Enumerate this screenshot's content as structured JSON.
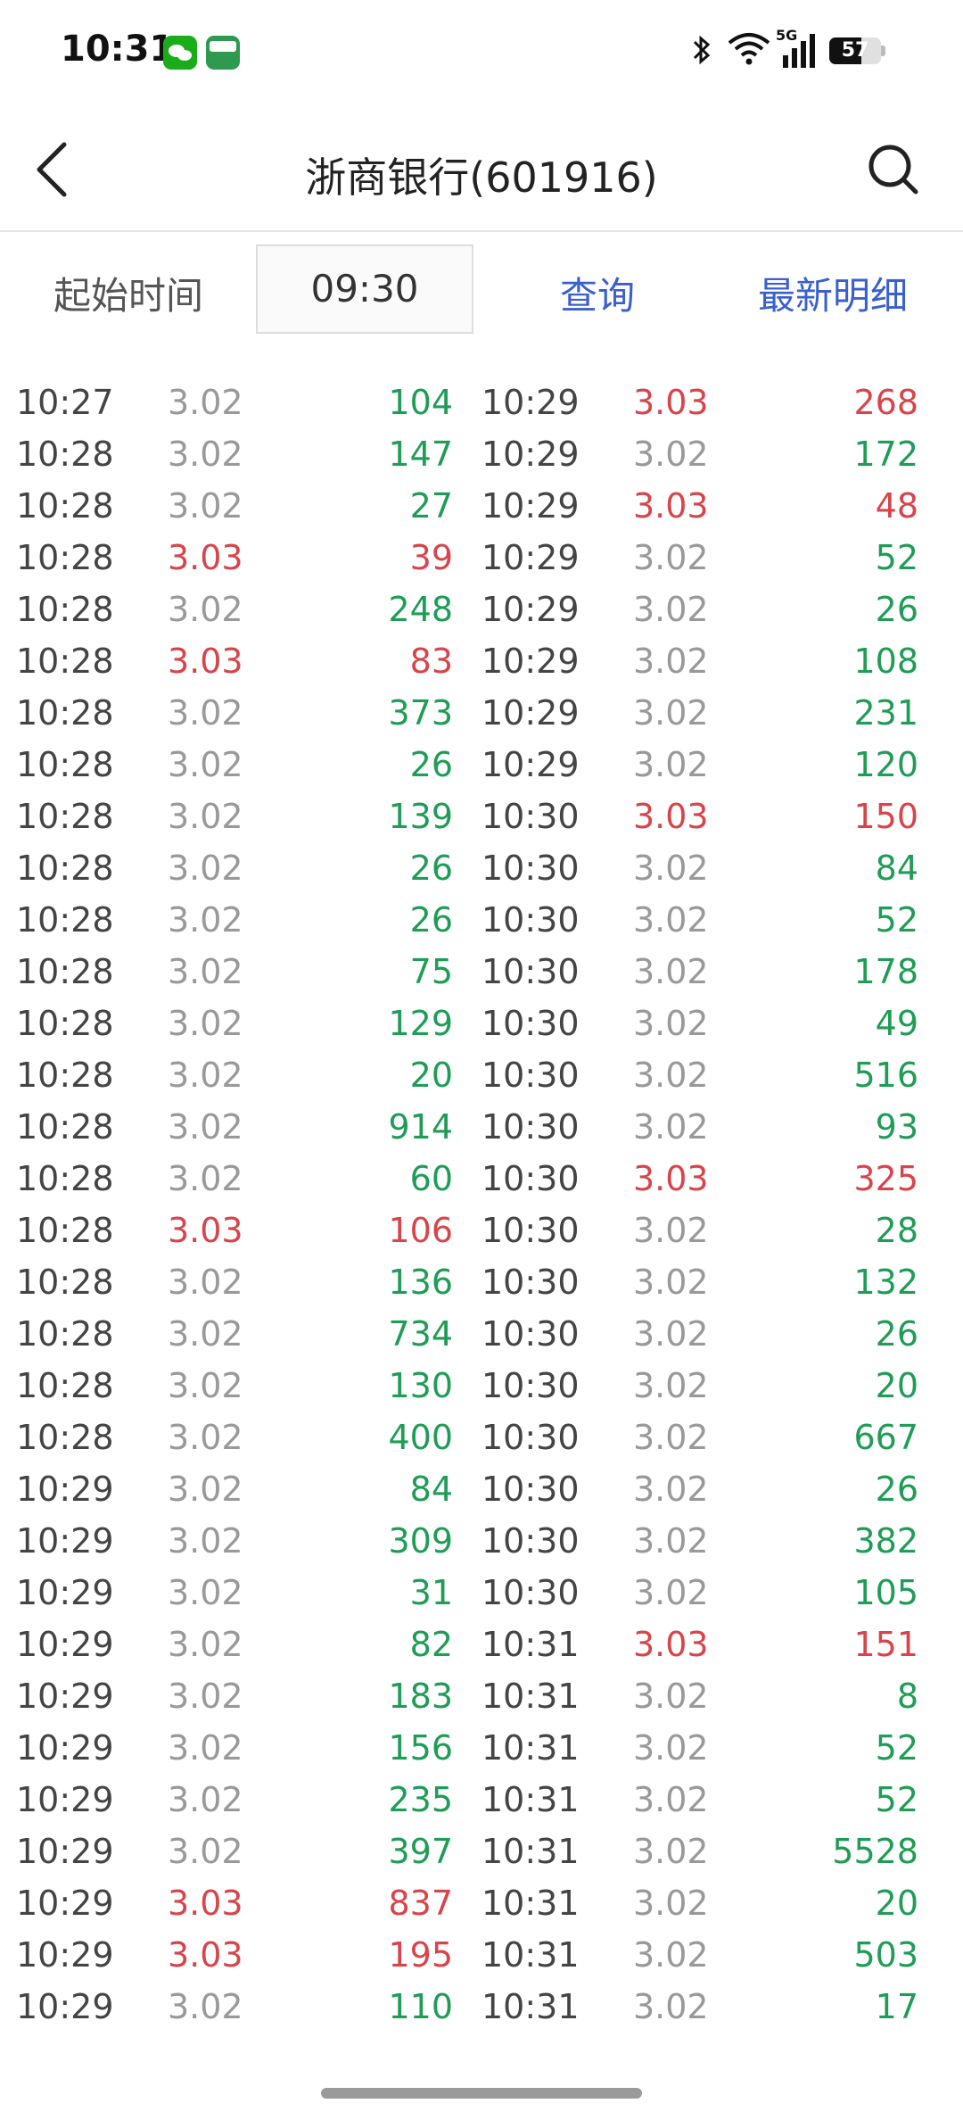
{
  "status_bar": {
    "time": "10:31",
    "battery": "57",
    "network": "5G",
    "icons": [
      "wechat-icon",
      "oppo-app-icon",
      "bluetooth-icon",
      "wifi-icon",
      "signal-icon",
      "battery-icon"
    ]
  },
  "header": {
    "title": "浙商银行(601916)",
    "back_icon": "back-arrow-icon",
    "search_icon": "search-icon"
  },
  "query": {
    "start_label": "起始时间",
    "start_time": "09:30",
    "query_button": "查询",
    "latest_button": "最新明细"
  },
  "colors": {
    "up": "#d7454b",
    "down": "#1f9c55",
    "flat": "#999999",
    "accent": "#3a5fcf"
  },
  "trades_left": [
    {
      "time": "10:27",
      "price": "3.02",
      "volume": "104",
      "dir": "down",
      "pdir": "flat"
    },
    {
      "time": "10:28",
      "price": "3.02",
      "volume": "147",
      "dir": "down",
      "pdir": "flat"
    },
    {
      "time": "10:28",
      "price": "3.02",
      "volume": "27",
      "dir": "down",
      "pdir": "flat"
    },
    {
      "time": "10:28",
      "price": "3.03",
      "volume": "39",
      "dir": "up",
      "pdir": "up"
    },
    {
      "time": "10:28",
      "price": "3.02",
      "volume": "248",
      "dir": "down",
      "pdir": "flat"
    },
    {
      "time": "10:28",
      "price": "3.03",
      "volume": "83",
      "dir": "up",
      "pdir": "up"
    },
    {
      "time": "10:28",
      "price": "3.02",
      "volume": "373",
      "dir": "down",
      "pdir": "flat"
    },
    {
      "time": "10:28",
      "price": "3.02",
      "volume": "26",
      "dir": "down",
      "pdir": "flat"
    },
    {
      "time": "10:28",
      "price": "3.02",
      "volume": "139",
      "dir": "down",
      "pdir": "flat"
    },
    {
      "time": "10:28",
      "price": "3.02",
      "volume": "26",
      "dir": "down",
      "pdir": "flat"
    },
    {
      "time": "10:28",
      "price": "3.02",
      "volume": "26",
      "dir": "down",
      "pdir": "flat"
    },
    {
      "time": "10:28",
      "price": "3.02",
      "volume": "75",
      "dir": "down",
      "pdir": "flat"
    },
    {
      "time": "10:28",
      "price": "3.02",
      "volume": "129",
      "dir": "down",
      "pdir": "flat"
    },
    {
      "time": "10:28",
      "price": "3.02",
      "volume": "20",
      "dir": "down",
      "pdir": "flat"
    },
    {
      "time": "10:28",
      "price": "3.02",
      "volume": "914",
      "dir": "down",
      "pdir": "flat"
    },
    {
      "time": "10:28",
      "price": "3.02",
      "volume": "60",
      "dir": "down",
      "pdir": "flat"
    },
    {
      "time": "10:28",
      "price": "3.03",
      "volume": "106",
      "dir": "up",
      "pdir": "up"
    },
    {
      "time": "10:28",
      "price": "3.02",
      "volume": "136",
      "dir": "down",
      "pdir": "flat"
    },
    {
      "time": "10:28",
      "price": "3.02",
      "volume": "734",
      "dir": "down",
      "pdir": "flat"
    },
    {
      "time": "10:28",
      "price": "3.02",
      "volume": "130",
      "dir": "down",
      "pdir": "flat"
    },
    {
      "time": "10:28",
      "price": "3.02",
      "volume": "400",
      "dir": "down",
      "pdir": "flat"
    },
    {
      "time": "10:29",
      "price": "3.02",
      "volume": "84",
      "dir": "down",
      "pdir": "flat"
    },
    {
      "time": "10:29",
      "price": "3.02",
      "volume": "309",
      "dir": "down",
      "pdir": "flat"
    },
    {
      "time": "10:29",
      "price": "3.02",
      "volume": "31",
      "dir": "down",
      "pdir": "flat"
    },
    {
      "time": "10:29",
      "price": "3.02",
      "volume": "82",
      "dir": "down",
      "pdir": "flat"
    },
    {
      "time": "10:29",
      "price": "3.02",
      "volume": "183",
      "dir": "down",
      "pdir": "flat"
    },
    {
      "time": "10:29",
      "price": "3.02",
      "volume": "156",
      "dir": "down",
      "pdir": "flat"
    },
    {
      "time": "10:29",
      "price": "3.02",
      "volume": "235",
      "dir": "down",
      "pdir": "flat"
    },
    {
      "time": "10:29",
      "price": "3.02",
      "volume": "397",
      "dir": "down",
      "pdir": "flat"
    },
    {
      "time": "10:29",
      "price": "3.03",
      "volume": "837",
      "dir": "up",
      "pdir": "up"
    },
    {
      "time": "10:29",
      "price": "3.03",
      "volume": "195",
      "dir": "up",
      "pdir": "up"
    },
    {
      "time": "10:29",
      "price": "3.02",
      "volume": "110",
      "dir": "down",
      "pdir": "flat"
    }
  ],
  "trades_right": [
    {
      "time": "10:29",
      "price": "3.03",
      "volume": "268",
      "dir": "up",
      "pdir": "up"
    },
    {
      "time": "10:29",
      "price": "3.02",
      "volume": "172",
      "dir": "down",
      "pdir": "flat"
    },
    {
      "time": "10:29",
      "price": "3.03",
      "volume": "48",
      "dir": "up",
      "pdir": "up"
    },
    {
      "time": "10:29",
      "price": "3.02",
      "volume": "52",
      "dir": "down",
      "pdir": "flat"
    },
    {
      "time": "10:29",
      "price": "3.02",
      "volume": "26",
      "dir": "down",
      "pdir": "flat"
    },
    {
      "time": "10:29",
      "price": "3.02",
      "volume": "108",
      "dir": "down",
      "pdir": "flat"
    },
    {
      "time": "10:29",
      "price": "3.02",
      "volume": "231",
      "dir": "down",
      "pdir": "flat"
    },
    {
      "time": "10:29",
      "price": "3.02",
      "volume": "120",
      "dir": "down",
      "pdir": "flat"
    },
    {
      "time": "10:30",
      "price": "3.03",
      "volume": "150",
      "dir": "up",
      "pdir": "up"
    },
    {
      "time": "10:30",
      "price": "3.02",
      "volume": "84",
      "dir": "down",
      "pdir": "flat"
    },
    {
      "time": "10:30",
      "price": "3.02",
      "volume": "52",
      "dir": "down",
      "pdir": "flat"
    },
    {
      "time": "10:30",
      "price": "3.02",
      "volume": "178",
      "dir": "down",
      "pdir": "flat"
    },
    {
      "time": "10:30",
      "price": "3.02",
      "volume": "49",
      "dir": "down",
      "pdir": "flat"
    },
    {
      "time": "10:30",
      "price": "3.02",
      "volume": "516",
      "dir": "down",
      "pdir": "flat"
    },
    {
      "time": "10:30",
      "price": "3.02",
      "volume": "93",
      "dir": "down",
      "pdir": "flat"
    },
    {
      "time": "10:30",
      "price": "3.03",
      "volume": "325",
      "dir": "up",
      "pdir": "up"
    },
    {
      "time": "10:30",
      "price": "3.02",
      "volume": "28",
      "dir": "down",
      "pdir": "flat"
    },
    {
      "time": "10:30",
      "price": "3.02",
      "volume": "132",
      "dir": "down",
      "pdir": "flat"
    },
    {
      "time": "10:30",
      "price": "3.02",
      "volume": "26",
      "dir": "down",
      "pdir": "flat"
    },
    {
      "time": "10:30",
      "price": "3.02",
      "volume": "20",
      "dir": "down",
      "pdir": "flat"
    },
    {
      "time": "10:30",
      "price": "3.02",
      "volume": "667",
      "dir": "down",
      "pdir": "flat"
    },
    {
      "time": "10:30",
      "price": "3.02",
      "volume": "26",
      "dir": "down",
      "pdir": "flat"
    },
    {
      "time": "10:30",
      "price": "3.02",
      "volume": "382",
      "dir": "down",
      "pdir": "flat"
    },
    {
      "time": "10:30",
      "price": "3.02",
      "volume": "105",
      "dir": "down",
      "pdir": "flat"
    },
    {
      "time": "10:31",
      "price": "3.03",
      "volume": "151",
      "dir": "up",
      "pdir": "up"
    },
    {
      "time": "10:31",
      "price": "3.02",
      "volume": "8",
      "dir": "down",
      "pdir": "flat"
    },
    {
      "time": "10:31",
      "price": "3.02",
      "volume": "52",
      "dir": "down",
      "pdir": "flat"
    },
    {
      "time": "10:31",
      "price": "3.02",
      "volume": "52",
      "dir": "down",
      "pdir": "flat"
    },
    {
      "time": "10:31",
      "price": "3.02",
      "volume": "5528",
      "dir": "down",
      "pdir": "flat"
    },
    {
      "time": "10:31",
      "price": "3.02",
      "volume": "20",
      "dir": "down",
      "pdir": "flat"
    },
    {
      "time": "10:31",
      "price": "3.02",
      "volume": "503",
      "dir": "down",
      "pdir": "flat"
    },
    {
      "time": "10:31",
      "price": "3.02",
      "volume": "17",
      "dir": "down",
      "pdir": "flat"
    }
  ]
}
